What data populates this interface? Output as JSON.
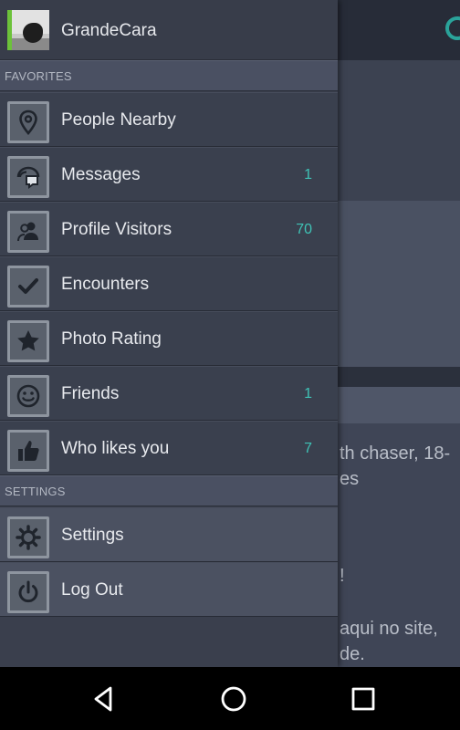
{
  "profile": {
    "name": "GrandeCara"
  },
  "sections": {
    "favorites": "FAVORITES",
    "settings": "SETTINGS"
  },
  "menu": [
    {
      "label": "People Nearby",
      "badge": "",
      "icon": "location-pin-icon"
    },
    {
      "label": "Messages",
      "badge": "1",
      "icon": "chat-bubbles-icon"
    },
    {
      "label": "Profile Visitors",
      "badge": "70",
      "icon": "visitors-icon"
    },
    {
      "label": "Encounters",
      "badge": "",
      "icon": "checkmark-icon"
    },
    {
      "label": "Photo Rating",
      "badge": "",
      "icon": "star-icon"
    },
    {
      "label": "Friends",
      "badge": "1",
      "icon": "smiley-icon"
    },
    {
      "label": "Who likes you",
      "badge": "7",
      "icon": "thumbs-up-icon"
    }
  ],
  "settings_menu": [
    {
      "label": "Settings",
      "icon": "gear-icon"
    },
    {
      "label": "Log Out",
      "icon": "power-icon"
    }
  ],
  "background_text": {
    "line1": "th chaser, 18-",
    "line2": "es",
    "line3": "!",
    "line4": "aqui no site,",
    "line5": "de."
  },
  "colors": {
    "badge": "#3fc3b6",
    "avatar_accent": "#6cc23a",
    "drawer_bg": "#3a3f4d"
  }
}
